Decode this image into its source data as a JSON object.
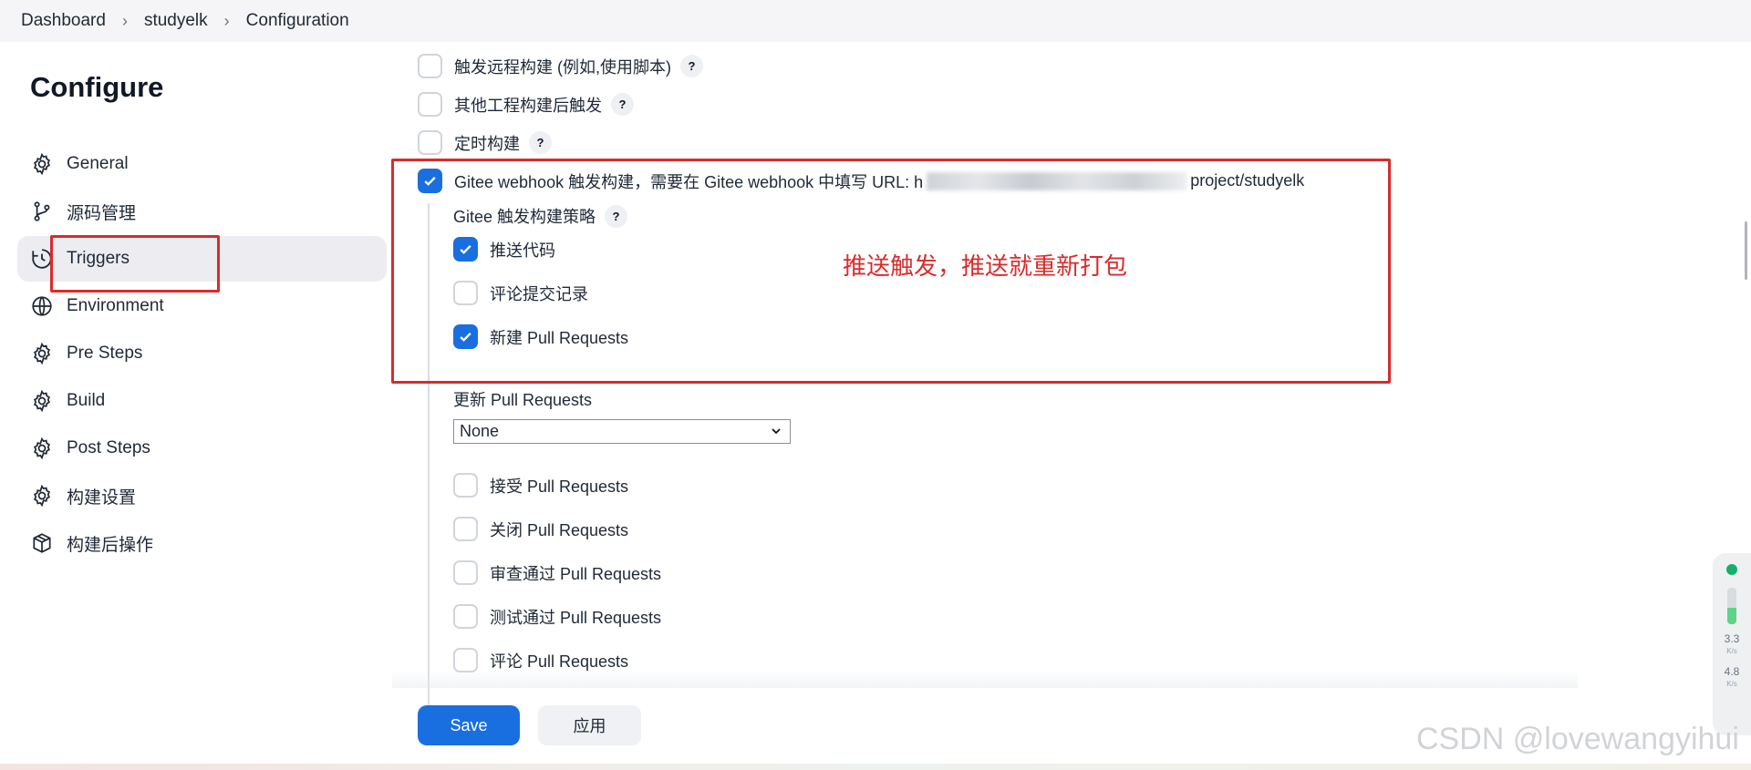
{
  "breadcrumb": [
    "Dashboard",
    "studyelk",
    "Configuration"
  ],
  "page_title": "Configure",
  "sidebar": {
    "items": [
      {
        "label": "General",
        "icon": "gear-icon"
      },
      {
        "label": "源码管理",
        "icon": "git-branch-icon"
      },
      {
        "label": "Triggers",
        "icon": "clock-icon"
      },
      {
        "label": "Environment",
        "icon": "globe-icon"
      },
      {
        "label": "Pre Steps",
        "icon": "gear-icon"
      },
      {
        "label": "Build",
        "icon": "gear-icon"
      },
      {
        "label": "Post Steps",
        "icon": "gear-icon"
      },
      {
        "label": "构建设置",
        "icon": "gear-icon"
      },
      {
        "label": "构建后操作",
        "icon": "package-icon"
      }
    ],
    "active": "Triggers"
  },
  "triggers": {
    "remote": {
      "label": "触发远程构建 (例如,使用脚本)",
      "checked": false
    },
    "after_other": {
      "label": "其他工程构建后触发",
      "checked": false
    },
    "timer": {
      "label": "定时构建",
      "checked": false
    },
    "gitee_prefix": "Gitee webhook 触发构建，需要在 Gitee webhook 中填写 URL: h",
    "gitee_suffix": "project/studyelk",
    "gitee_checked": true,
    "strategy_label": "Gitee 触发构建策略",
    "push": {
      "label": "推送代码",
      "checked": true
    },
    "comment_commit": {
      "label": "评论提交记录",
      "checked": false
    },
    "new_pr": {
      "label": "新建 Pull Requests",
      "checked": true
    },
    "update_pr_label": "更新 Pull Requests",
    "update_pr_value": "None",
    "accept_pr": {
      "label": "接受 Pull Requests",
      "checked": false
    },
    "close_pr": {
      "label": "关闭 Pull Requests",
      "checked": false
    },
    "review_pr": {
      "label": "审查通过 Pull Requests",
      "checked": false
    },
    "test_pr": {
      "label": "测试通过 Pull Requests",
      "checked": false
    },
    "comment_pr": {
      "label": "评论 Pull Requests",
      "checked": false
    }
  },
  "annotation": "推送触发，推送就重新打包",
  "buttons": {
    "save": "Save",
    "apply": "应用"
  },
  "widget": {
    "up": "3.3",
    "up_unit": "K/s",
    "down": "4.8",
    "down_unit": "K/s"
  },
  "watermark": "CSDN @lovewangyihui",
  "colors": {
    "accent": "#1a6fe0",
    "annotation": "#d92b2b"
  }
}
